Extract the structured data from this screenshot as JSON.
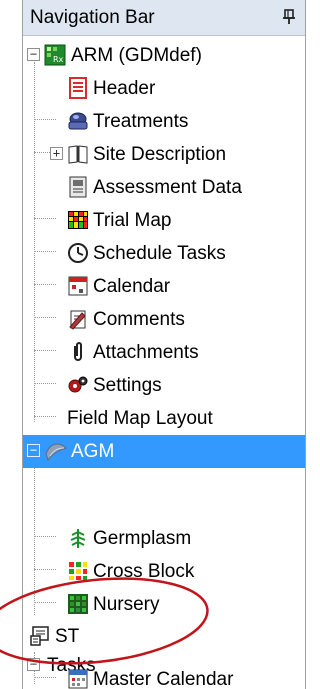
{
  "navigation_bar": {
    "title": "Navigation Bar",
    "pin_glyph": "📌"
  },
  "tree": {
    "root_arm": {
      "label": "ARM (GDMdef)",
      "expander": "−"
    },
    "arm_items": [
      {
        "label": "Header",
        "icon": "header-icon"
      },
      {
        "label": "Treatments",
        "icon": "treatments-icon"
      },
      {
        "label": "Site Description",
        "icon": "book-icon",
        "expander": "+"
      },
      {
        "label": "Assessment Data",
        "icon": "assessment-data-icon"
      },
      {
        "label": "Trial Map",
        "icon": "trial-map-icon"
      },
      {
        "label": "Schedule Tasks",
        "icon": "clock-icon"
      },
      {
        "label": "Calendar",
        "icon": "calendar-icon"
      },
      {
        "label": "Comments",
        "icon": "comments-icon"
      },
      {
        "label": "Attachments",
        "icon": "paperclip-icon"
      },
      {
        "label": "Settings",
        "icon": "settings-icon"
      },
      {
        "label": "Field Map Layout"
      }
    ],
    "root_agm": {
      "label": "AGM",
      "expander": "−"
    },
    "agm_items": [
      {
        "label": "Germplasm",
        "icon": "germplasm-icon"
      },
      {
        "label": "Cross Block",
        "icon": "cross-block-icon"
      },
      {
        "label": "Nursery",
        "icon": "nursery-icon"
      }
    ],
    "root_st": {
      "label": "ST"
    },
    "root_tasks": {
      "label": "Tasks",
      "expander": "−"
    },
    "tasks_items": [
      {
        "label": "Master Calendar",
        "icon": "master-calendar-icon"
      }
    ]
  },
  "colors": {
    "selection": "#3399ff",
    "annotation_circle": "#c0161b",
    "titlebar": "#dde6f1"
  }
}
